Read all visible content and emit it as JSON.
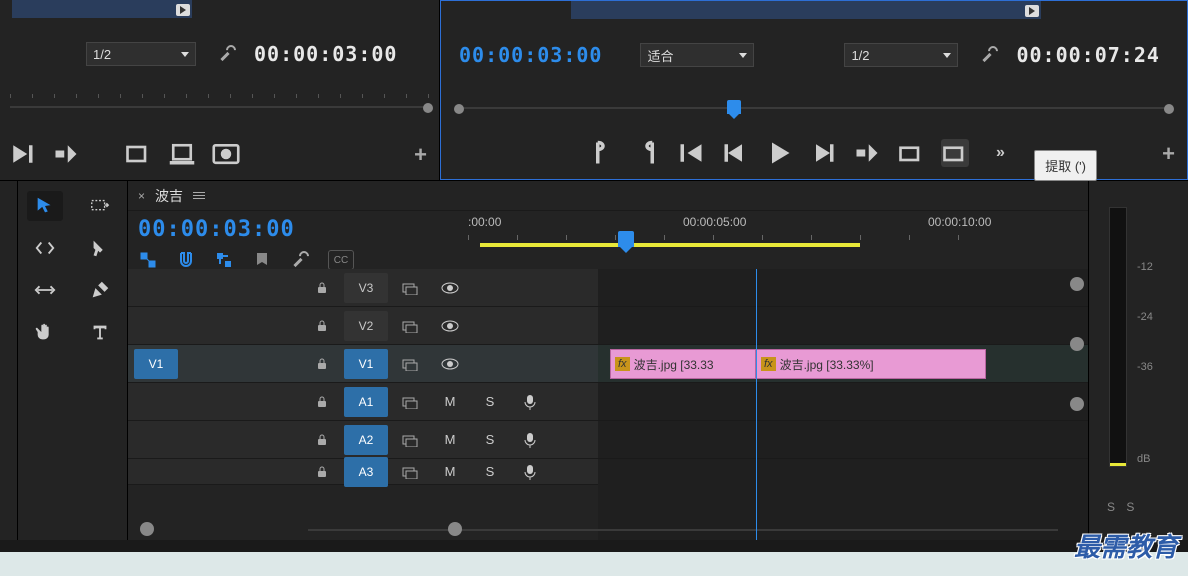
{
  "source_monitor": {
    "zoom": "1/2",
    "timecode": "00:00:03:00"
  },
  "program_monitor": {
    "in_tc": "00:00:03:00",
    "fit_label": "适合",
    "zoom": "1/2",
    "duration": "00:00:07:24",
    "tooltip": "提取 (')"
  },
  "timeline": {
    "sequence_name": "波吉",
    "playhead_tc": "00:00:03:00",
    "ruler": {
      "t0": ":00:00",
      "t1": "00:00:05:00",
      "t2": "00:00:10:00"
    },
    "tracks": {
      "v3": "V3",
      "v2": "V2",
      "v1": "V1",
      "a1": "A1",
      "a2": "A2",
      "a3": "A3",
      "target_v1": "V1"
    },
    "toggles": {
      "m": "M",
      "s": "S"
    },
    "clips": [
      {
        "fx": "fx",
        "label": "波吉.jpg [33.33"
      },
      {
        "fx": "fx",
        "label": "波吉.jpg [33.33%]"
      }
    ]
  },
  "meter": {
    "db12": "-12",
    "db24": "-24",
    "db36": "-36",
    "dblabel": "dB",
    "ss": "S S"
  },
  "watermark": "最需教育"
}
